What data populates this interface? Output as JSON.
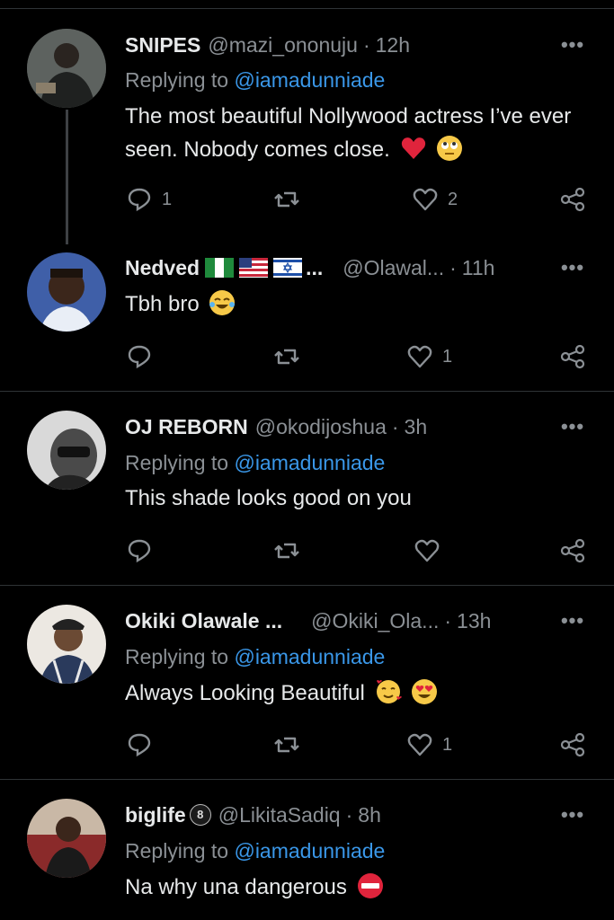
{
  "tweets": [
    {
      "name": "SNIPES",
      "handle": "@mazi_ononuju",
      "time": "12h",
      "replying_prefix": "Replying to ",
      "replying_to": "@iamadunniade",
      "text": "The most beautiful Nollywood actress I’ve ever seen. Nobody comes close.",
      "emojis": [
        "red-heart",
        "face-with-rolling-eyes"
      ],
      "reply_count": "1",
      "retweet_count": "",
      "like_count": "2"
    },
    {
      "name": "Nedved",
      "flags": [
        "nigeria-flag",
        "usa-flag",
        "israel-flag"
      ],
      "name_suffix": "...",
      "handle": "@Olawal...",
      "time": "11h",
      "text": "Tbh bro",
      "emojis": [
        "face-with-tears-of-joy"
      ],
      "reply_count": "",
      "retweet_count": "",
      "like_count": "1"
    },
    {
      "name": "OJ REBORN",
      "handle": "@okodijoshua",
      "time": "3h",
      "replying_prefix": "Replying to ",
      "replying_to": "@iamadunniade",
      "text": "This shade looks good on you",
      "emojis": [],
      "reply_count": "",
      "retweet_count": "",
      "like_count": ""
    },
    {
      "name": "Okiki Olawale ...",
      "handle": "@Okiki_Ola...",
      "time": "13h",
      "replying_prefix": "Replying to ",
      "replying_to": "@iamadunniade",
      "text": "Always Looking Beautiful",
      "emojis": [
        "smiling-face-with-hearts",
        "heart-eyes"
      ],
      "reply_count": "",
      "retweet_count": "",
      "like_count": "1"
    },
    {
      "name": "biglife",
      "badge": "8",
      "handle": "@LikitaSadiq",
      "time": "8h",
      "replying_prefix": "Replying to ",
      "replying_to": "@iamadunniade",
      "text": "Na why una dangerous",
      "emojis": [
        "no-entry"
      ]
    }
  ],
  "ui": {
    "dot": "·",
    "more": "•••"
  },
  "colors": {
    "background": "#000000",
    "text": "#e7e9ea",
    "secondary": "#8b9095",
    "mention": "#3a97e8",
    "divider": "#2f3336"
  }
}
